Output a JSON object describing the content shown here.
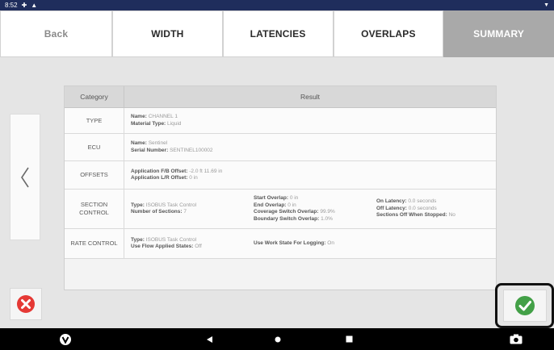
{
  "status_bar": {
    "time": "8:52",
    "icons": [
      "plus-icon",
      "warning-icon"
    ],
    "right_icon": "wifi-icon"
  },
  "tabs": [
    {
      "label": "Back"
    },
    {
      "label": "WIDTH"
    },
    {
      "label": "LATENCIES"
    },
    {
      "label": "OVERLAPS"
    },
    {
      "label": "SUMMARY",
      "active": true
    }
  ],
  "table": {
    "headers": {
      "category": "Category",
      "result": "Result"
    },
    "rows": [
      {
        "category": "TYPE",
        "col1": [
          {
            "label": "Name:",
            "value": "CHANNEL 1"
          },
          {
            "label": "Material Type:",
            "value": "Liquid"
          }
        ]
      },
      {
        "category": "ECU",
        "col1": [
          {
            "label": "Name:",
            "value": "Sentinel"
          },
          {
            "label": "Serial Number:",
            "value": "SENTINEL100002"
          }
        ]
      },
      {
        "category": "OFFSETS",
        "col1": [
          {
            "label": "Application F/B Offset:",
            "value": "-2.0 ft 11.69 in"
          },
          {
            "label": "Application L/R Offset:",
            "value": "0 in"
          }
        ]
      },
      {
        "category": "SECTION CONTROL",
        "col1": [
          {
            "label": "Type:",
            "value": "ISOBUS Task Control"
          },
          {
            "label": "Number of Sections:",
            "value": "7"
          }
        ],
        "col2": [
          {
            "label": "Start Overlap:",
            "value": "0 in"
          },
          {
            "label": "End Overlap:",
            "value": "0 in"
          },
          {
            "label": "Coverage Switch Overlap:",
            "value": "99.9%"
          },
          {
            "label": "Boundary Switch Overlap:",
            "value": "1.0%"
          }
        ],
        "col3": [
          {
            "label": "On Latency:",
            "value": "0.0 seconds"
          },
          {
            "label": "Off Latency:",
            "value": "0.0 seconds"
          },
          {
            "label": "Sections Off When Stopped:",
            "value": "No"
          }
        ]
      },
      {
        "category": "RATE CONTROL",
        "col1": [
          {
            "label": "Type:",
            "value": "ISOBUS Task Control"
          },
          {
            "label": "Use Flow Applied States:",
            "value": "Off"
          }
        ],
        "col2": [
          {
            "label": "Use Work State For Logging:",
            "value": "On"
          }
        ]
      }
    ]
  },
  "buttons": {
    "prev": "chevron-left-icon",
    "cancel": "cancel-icon",
    "confirm": "check-icon"
  },
  "nav_bar": [
    "app-logo-icon",
    "back-icon",
    "home-icon",
    "recents-icon",
    "camera-icon"
  ],
  "colors": {
    "status_bar": "#1f2d5c",
    "active_tab": "#a9a9a9",
    "cancel": "#e53935",
    "confirm": "#43a047"
  }
}
